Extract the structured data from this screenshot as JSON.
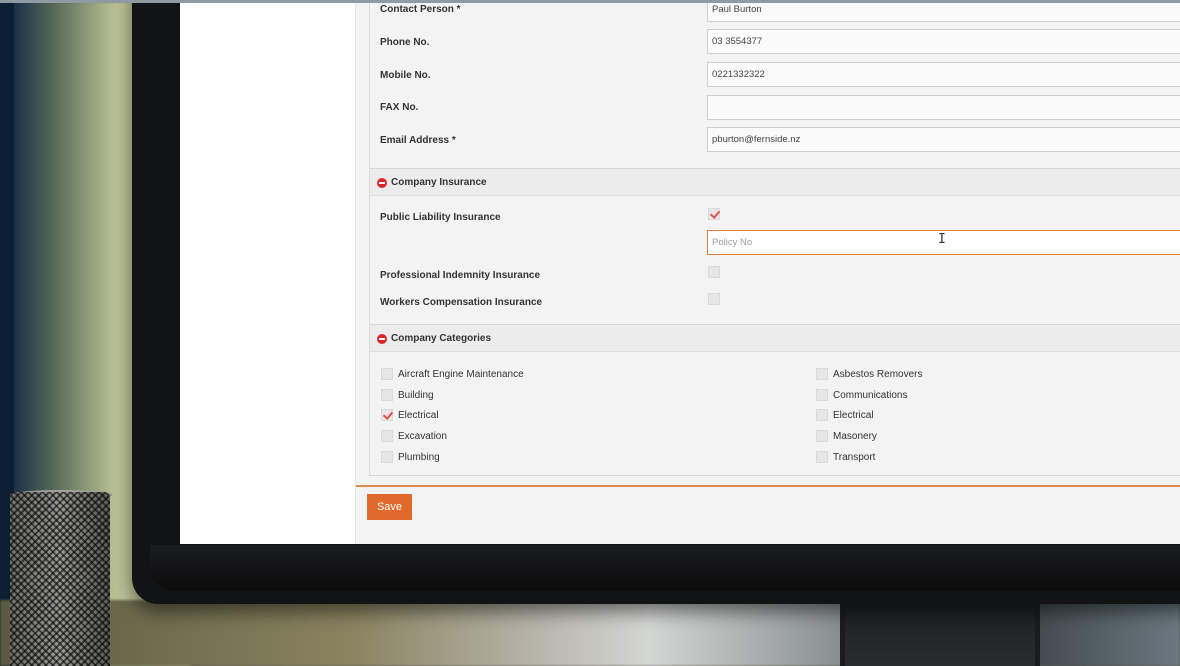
{
  "contact": {
    "fields": [
      {
        "label": "Contact Person *",
        "value": "Paul Burton"
      },
      {
        "label": "Phone No.",
        "value": "03 3554377"
      },
      {
        "label": "Mobile No.",
        "value": "0221332322"
      },
      {
        "label": "FAX No.",
        "value": ""
      },
      {
        "label": "Email Address *",
        "value": "pburton@fernside.nz"
      }
    ]
  },
  "insurance": {
    "title": "Company Insurance",
    "items": [
      {
        "label": "Public Liability Insurance",
        "checked": true
      },
      {
        "label": "Professional Indemnity Insurance",
        "checked": false
      },
      {
        "label": "Workers Compensation Insurance",
        "checked": false
      }
    ],
    "policy_placeholder": "Policy No"
  },
  "categories": {
    "title": "Company Categories",
    "left": [
      {
        "label": "Aircraft Engine Maintenance",
        "checked": false
      },
      {
        "label": "Building",
        "checked": false
      },
      {
        "label": "Electrical",
        "checked": true
      },
      {
        "label": "Excavation",
        "checked": false
      },
      {
        "label": "Plumbing",
        "checked": false
      }
    ],
    "right": [
      {
        "label": "Asbestos Removers",
        "checked": false
      },
      {
        "label": "Communications",
        "checked": false
      },
      {
        "label": "Electrical",
        "checked": false
      },
      {
        "label": "Masonery",
        "checked": false
      },
      {
        "label": "Transport",
        "checked": false
      }
    ]
  },
  "actions": {
    "save_label": "Save"
  },
  "colors": {
    "accent": "#e0692c",
    "section_icon": "#d9262b",
    "check": "#d9534f"
  }
}
